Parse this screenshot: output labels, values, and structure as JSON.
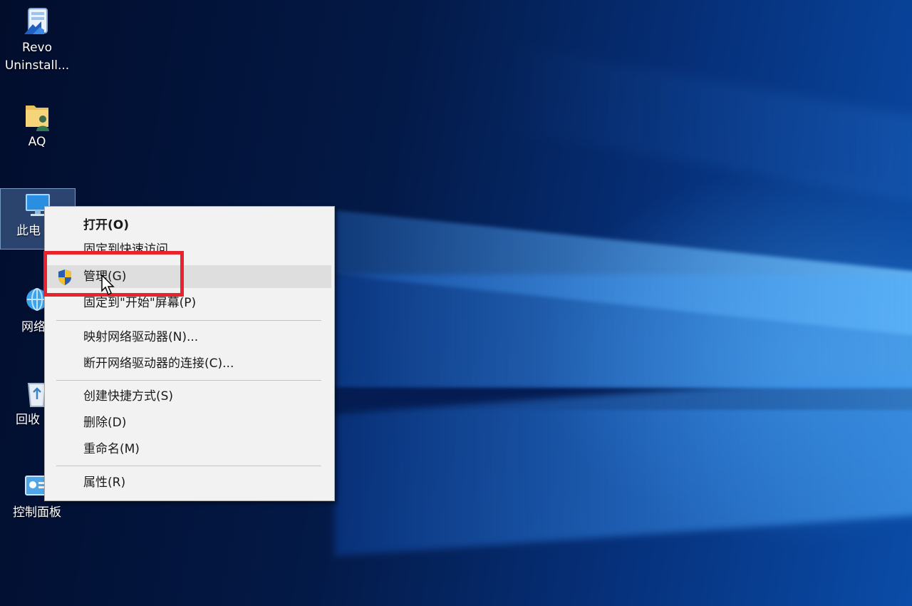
{
  "desktop": {
    "icons": [
      {
        "label_line1": "Revo",
        "label_line2": "Uninstall...",
        "icon": "revo-uninstaller-icon"
      },
      {
        "label": "AQ",
        "icon": "user-folder-icon"
      },
      {
        "label": "此电",
        "icon": "this-pc-icon",
        "selected": true
      },
      {
        "label": "网络",
        "icon": "network-icon"
      },
      {
        "label": "回收",
        "icon": "recycle-bin-icon"
      },
      {
        "label": "控制面板",
        "icon": "control-panel-icon"
      }
    ]
  },
  "context_menu": {
    "items": [
      {
        "label": "打开(O)",
        "bold": true
      },
      {
        "label": "固定到快速访问"
      },
      {
        "label": "管理(G)",
        "icon": "uac-shield-icon",
        "hovered": true
      },
      {
        "label": "固定到\"开始\"屏幕(P)"
      },
      {
        "label": "映射网络驱动器(N)..."
      },
      {
        "label": "断开网络驱动器的连接(C)..."
      },
      {
        "label": "创建快捷方式(S)"
      },
      {
        "label": "删除(D)"
      },
      {
        "label": "重命名(M)"
      },
      {
        "label": "属性(R)"
      }
    ]
  },
  "colors": {
    "highlight_box": "#e8232b",
    "menu_background": "#f2f2f2",
    "hover_background": "#dedede",
    "wallpaper_dark": "#03123a",
    "wallpaper_light": "#5ab0f5"
  }
}
